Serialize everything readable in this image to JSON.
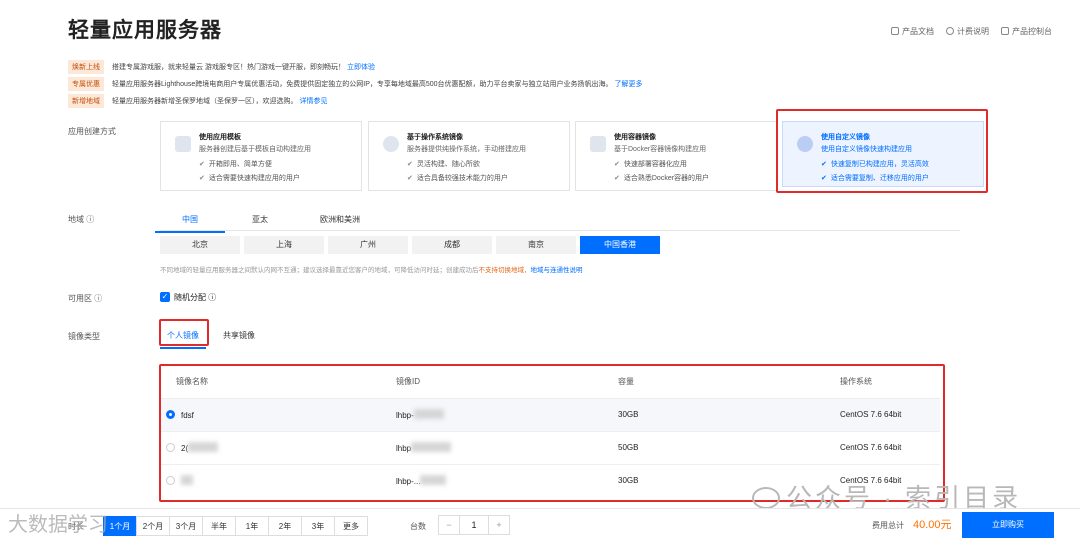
{
  "title": "轻量应用服务器",
  "toplinks": [
    "产品文档",
    "计费说明",
    "产品控制台"
  ],
  "notices": [
    {
      "tag": "焕新上线",
      "text": "搭建专属游戏服，就来轻量云 游戏服专区！热门游戏一键开服，即刻畅玩！",
      "link": "立即体验"
    },
    {
      "tag": "专属优惠",
      "text": "轻量应用服务器Lighthouse跨境电商用户专属优惠活动，免费提供固定独立的公网IP，专享每地域最高500台优惠配额，助力平台卖家与独立站用户业务扬帆出海。",
      "link": "了解更多"
    },
    {
      "tag": "新增地域",
      "text": "轻量应用服务器新增圣保罗地域（圣保罗一区），欢迎选购。",
      "link": "详情参见"
    }
  ],
  "create_label": "应用创建方式",
  "cards": [
    {
      "title": "使用应用模板",
      "desc": "服务器创建后基于模板自动构建应用",
      "b1": "开箱即用、简单方便",
      "b2": "适合需要快速构建应用的用户"
    },
    {
      "title": "基于操作系统镜像",
      "desc": "服务器提供纯操作系统，手动搭建应用",
      "b1": "灵活构建、随心所欲",
      "b2": "适合具备较强技术能力的用户"
    },
    {
      "title": "使用容器镜像",
      "desc": "基于Docker容器镜像构建应用",
      "b1": "快速部署容器化应用",
      "b2": "适合熟悉Docker容器的用户"
    },
    {
      "title": "使用自定义镜像",
      "desc": "使用自定义镜像快速构建应用",
      "b1": "快速复制已构建应用，灵活高效",
      "b2": "适合需要复制、迁移应用的用户"
    }
  ],
  "region_label": "地域",
  "region_tabs": [
    "中国",
    "亚太",
    "欧洲和美洲"
  ],
  "cities": [
    "北京",
    "上海",
    "广州",
    "成都",
    "南京",
    "中国香港"
  ],
  "region_tip": {
    "text": "不同地域的轻量应用服务器之间默认内网不互通；建议选择最靠近您客户的地域，可降低访问时延；创建成功后",
    "warn": "不支持切换地域",
    "link": "地域与连通性说明"
  },
  "zone_label": "可用区",
  "zone_value": "随机分配",
  "image_label": "镜像类型",
  "image_tabs": [
    "个人镜像",
    "共享镜像"
  ],
  "table": {
    "headers": [
      "镜像名称",
      "镜像ID",
      "容量",
      "操作系统"
    ],
    "rows": [
      {
        "name": "fdsf",
        "id": "lhbp-",
        "size": "30GB",
        "os": "CentOS 7.6 64bit"
      },
      {
        "name": "2(",
        "id": "lhbp",
        "size": "50GB",
        "os": "CentOS 7.6 64bit"
      },
      {
        "name": "",
        "id": "lhbp-...",
        "size": "30GB",
        "os": "CentOS 7.6 64bit"
      }
    ]
  },
  "periods": [
    "1个月",
    "2个月",
    "3个月",
    "半年",
    "1年",
    "2年",
    "3年",
    "更多"
  ],
  "duration_label": "时长",
  "qty_label": "台数",
  "qty": {
    "minus": "−",
    "value": "1",
    "plus": "+"
  },
  "total_label": "费用总计",
  "total_value": "40.00元",
  "buy_label": "立即购买",
  "watermark": "公众号 · 索引目录",
  "watermark2": "大数据学习"
}
